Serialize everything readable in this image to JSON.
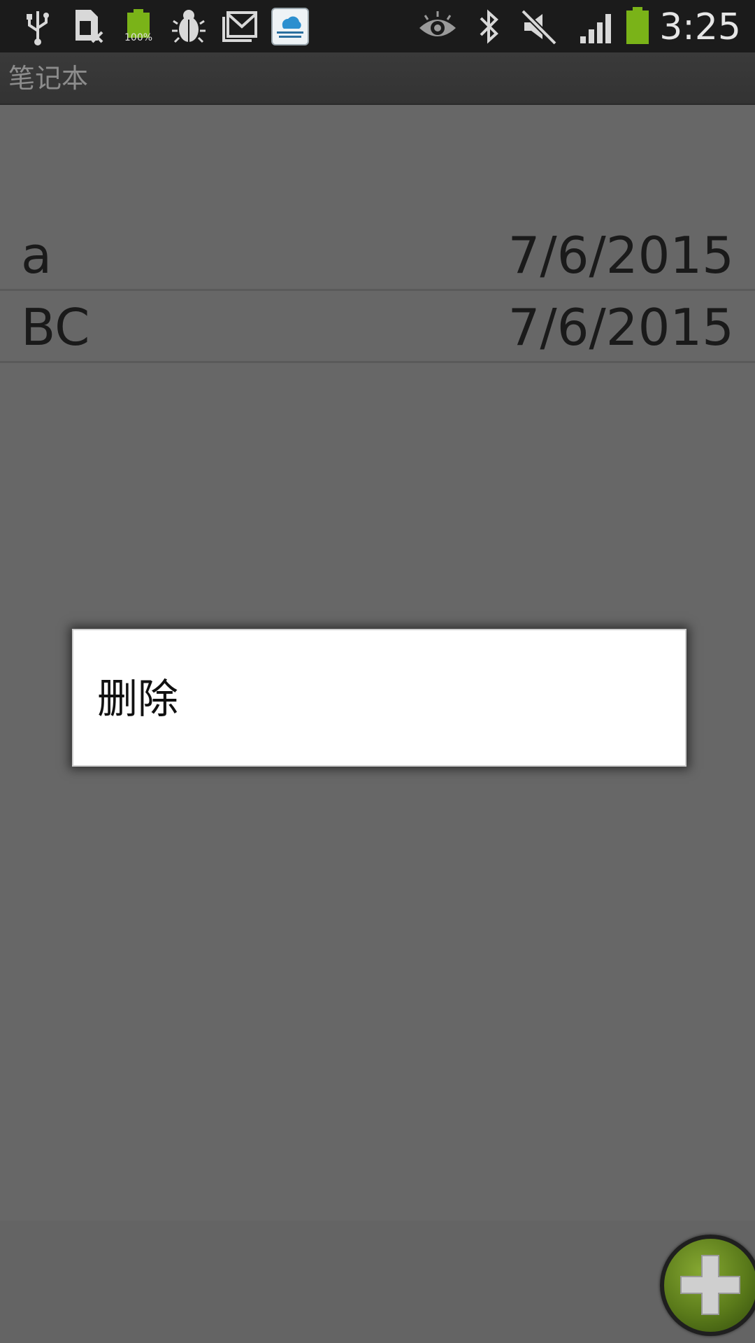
{
  "status_bar": {
    "time": "3:25",
    "battery_notification_text": "100%",
    "icons": [
      "usb-icon",
      "sim-card-disabled-icon",
      "battery-full-icon",
      "debug-bug-icon",
      "gmail-icon",
      "cloud-testing-service-icon",
      "eye-icon",
      "bluetooth-icon",
      "sound-muted-icon",
      "signal-strength-icon",
      "battery-icon"
    ],
    "cloud_app_label": "Cloud Testing Service NTUT"
  },
  "action_bar": {
    "title": "笔记本"
  },
  "notes": [
    {
      "title": "a",
      "date": "7/6/2015"
    },
    {
      "title": "BC",
      "date": "7/6/2015"
    }
  ],
  "context_dialog": {
    "items": [
      {
        "label": "删除"
      }
    ]
  },
  "fab": {
    "icon": "plus-icon"
  },
  "colors": {
    "status_bar_bg": "#1b1b1b",
    "dim_overlay_bg": "#676767",
    "dialog_bg": "#ffffff",
    "fab_green": "#6b8e23"
  }
}
